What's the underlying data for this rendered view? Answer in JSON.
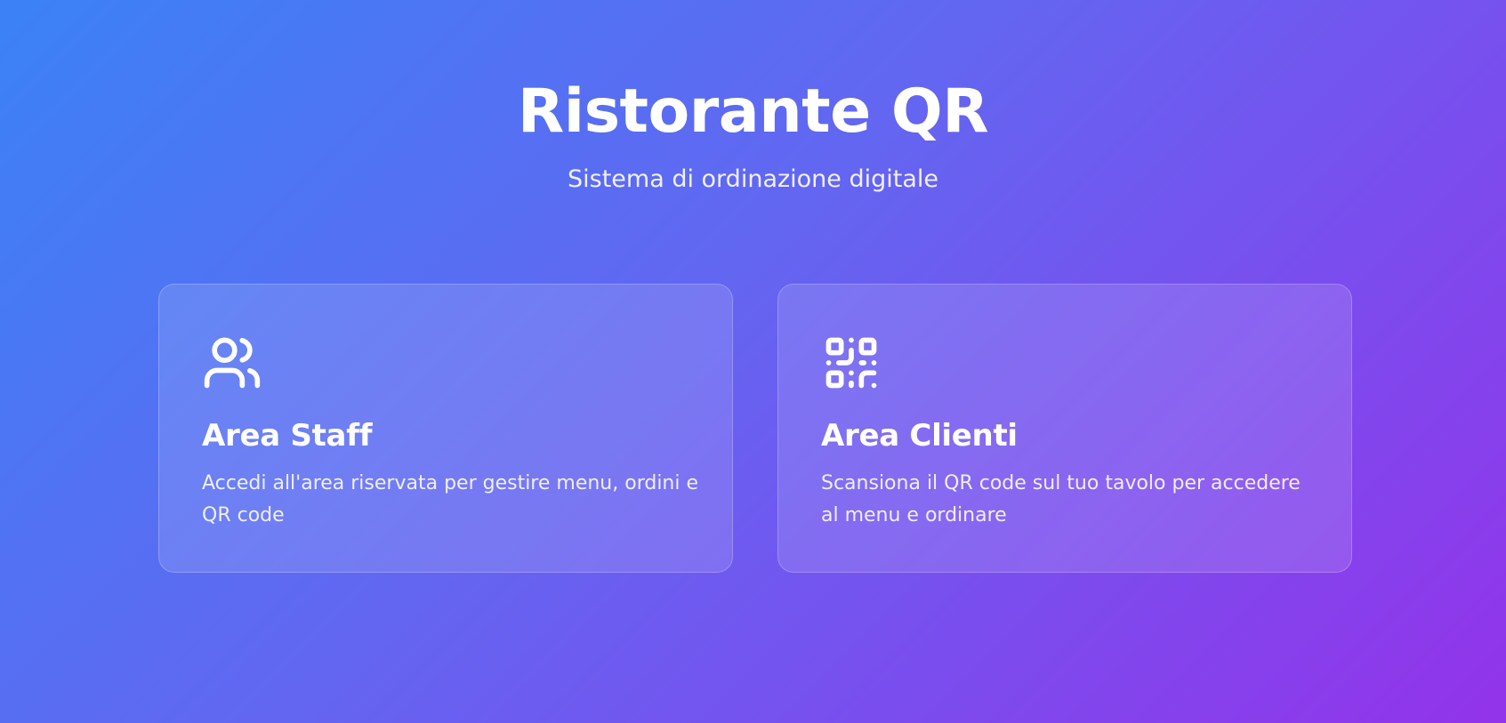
{
  "header": {
    "title": "Ristorante QR",
    "subtitle": "Sistema di ordinazione digitale"
  },
  "cards": [
    {
      "icon": "users-icon",
      "title": "Area Staff",
      "description": "Accedi all'area riservata per gestire menu, ordini e QR code"
    },
    {
      "icon": "qr-code-icon",
      "title": "Area Clienti",
      "description": "Scansiona il QR code sul tuo tavolo per accedere al menu e ordinare"
    }
  ],
  "colors": {
    "gradient_start": "#3b82f6",
    "gradient_mid": "#6366f1",
    "gradient_end": "#9333ea",
    "text": "#ffffff"
  }
}
